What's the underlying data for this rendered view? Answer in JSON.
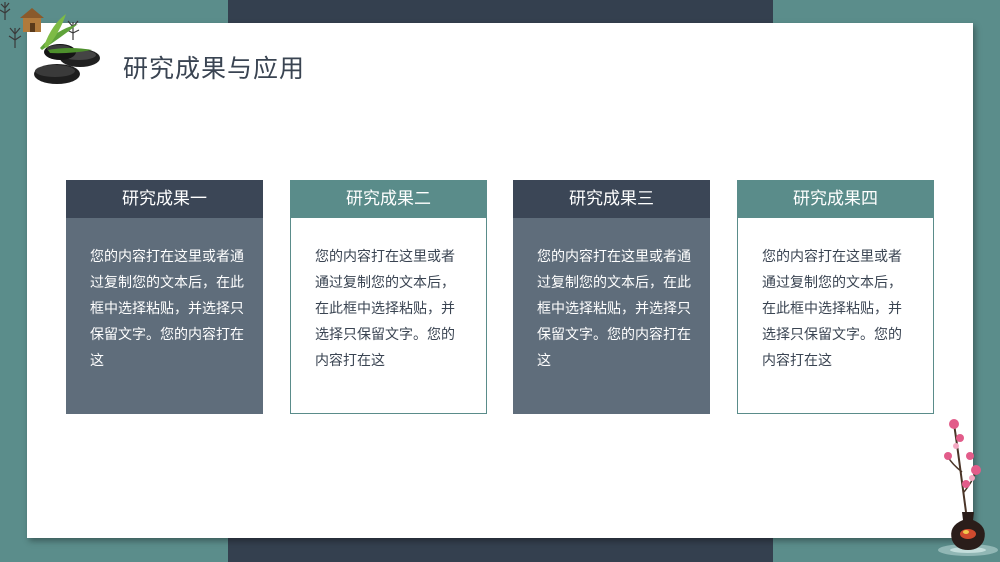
{
  "slide": {
    "title": "研究成果与应用"
  },
  "cards": [
    {
      "heading": "研究成果一",
      "body": "您的内容打在这里或者通过复制您的文本后，在此框中选择粘贴，并选择只保留文字。您的内容打在这"
    },
    {
      "heading": "研究成果二",
      "body": "您的内容打在这里或者通过复制您的文本后，在此框中选择粘贴，并选择只保留文字。您的内容打在这"
    },
    {
      "heading": "研究成果三",
      "body": "您的内容打在这里或者通过复制您的文本后，在此框中选择粘贴，并选择只保留文字。您的内容打在这"
    },
    {
      "heading": "研究成果四",
      "body": "您的内容打在这里或者通过复制您的文本后，在此框中选择粘贴，并选择只保留文字。您的内容打在这"
    }
  ],
  "colors": {
    "background": "#5b8d8b",
    "dark_band": "#34404f",
    "card_dark_head": "#3b4656",
    "card_dark_body": "#5f6d7b",
    "card_teal": "#5a8c8a",
    "title_text": "#3a4452"
  },
  "icons": [
    "zen-stones-decoration",
    "bamboo-leaf-decoration",
    "hut-decoration",
    "plum-blossom-vase-decoration"
  ]
}
